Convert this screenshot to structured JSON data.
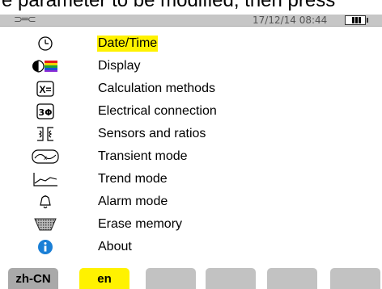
{
  "caption": "e parameter to be modified, then press",
  "status": {
    "left_icon": "connection-icon",
    "datetime": "17/12/14  08:44",
    "battery_icon": "battery-icon"
  },
  "menu": {
    "selected_index": 0,
    "items": [
      {
        "label": "Date/Time",
        "icon": "clock-icon"
      },
      {
        "label": "Display",
        "icon": "display-icon"
      },
      {
        "label": "Calculation methods",
        "icon": "calculation-icon"
      },
      {
        "label": "Electrical connection",
        "icon": "three-phase-icon"
      },
      {
        "label": "Sensors and ratios",
        "icon": "sensor-icon"
      },
      {
        "label": "Transient mode",
        "icon": "transient-icon"
      },
      {
        "label": "Trend mode",
        "icon": "trend-icon"
      },
      {
        "label": "Alarm mode",
        "icon": "bell-icon"
      },
      {
        "label": "Erase memory",
        "icon": "erase-icon"
      },
      {
        "label": "About",
        "icon": "info-icon"
      }
    ]
  },
  "function_keys": [
    {
      "label": "zh-CN"
    },
    {
      "label": "en"
    },
    {
      "label": ""
    },
    {
      "label": ""
    },
    {
      "label": ""
    },
    {
      "label": ""
    }
  ],
  "colors": {
    "selection": "#fff200",
    "statusbar": "#c6c6c6",
    "key": "#c2c2c2",
    "info_blue": "#1a7fd6"
  }
}
